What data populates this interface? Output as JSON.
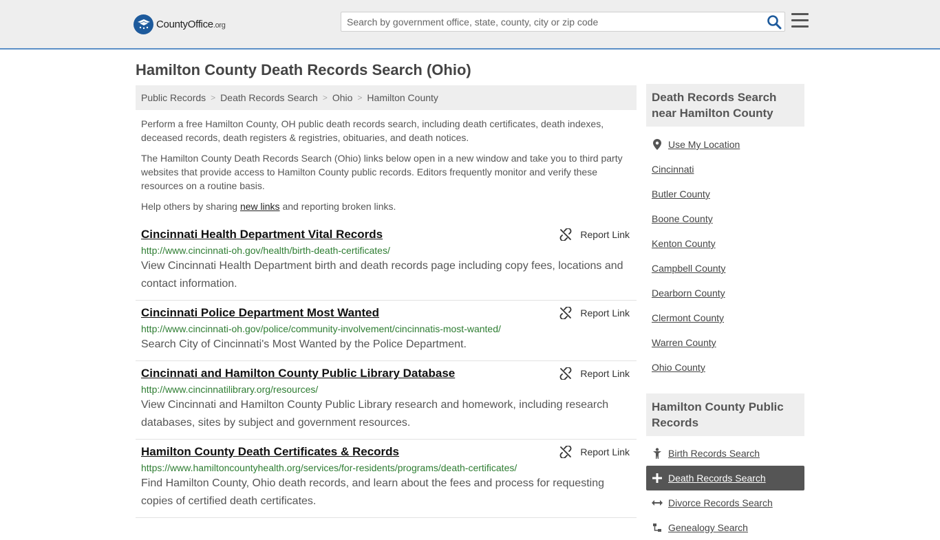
{
  "header": {
    "logo_main": "CountyOffice",
    "logo_tld": ".org",
    "search_placeholder": "Search by government office, state, county, city or zip code"
  },
  "page": {
    "title": "Hamilton County Death Records Search (Ohio)"
  },
  "breadcrumb": [
    "Public Records",
    "Death Records Search",
    "Ohio",
    "Hamilton County"
  ],
  "intro": {
    "p1": "Perform a free Hamilton County, OH public death records search, including death certificates, death indexes, deceased records, death registers & registries, obituaries, and death notices.",
    "p2": "The Hamilton County Death Records Search (Ohio) links below open in a new window and take you to third party websites that provide access to Hamilton County public records. Editors frequently monitor and verify these resources on a routine basis.",
    "p3_before": "Help others by sharing ",
    "p3_link": "new links",
    "p3_after": " and reporting broken links."
  },
  "report_label": "Report Link",
  "results": [
    {
      "title": "Cincinnati Health Department Vital Records",
      "url": "http://www.cincinnati-oh.gov/health/birth-death-certificates/",
      "desc": "View Cincinnati Health Department birth and death records page including copy fees, locations and contact information."
    },
    {
      "title": "Cincinnati Police Department Most Wanted",
      "url": "http://www.cincinnati-oh.gov/police/community-involvement/cincinnatis-most-wanted/",
      "desc": "Search City of Cincinnati's Most Wanted by the Police Department."
    },
    {
      "title": "Cincinnati and Hamilton County Public Library Database",
      "url": "http://www.cincinnatilibrary.org/resources/",
      "desc": "View Cincinnati and Hamilton County Public Library research and homework, including research databases, sites by subject and government resources."
    },
    {
      "title": "Hamilton County Death Certificates & Records",
      "url": "https://www.hamiltoncountyhealth.org/services/for-residents/programs/death-certificates/",
      "desc": "Find Hamilton County, Ohio death records, and learn about the fees and process for requesting copies of certified death certificates."
    }
  ],
  "sidebar": {
    "near_title": "Death Records Search near Hamilton County",
    "use_location": "Use My Location",
    "near_items": [
      "Cincinnati",
      "Butler County",
      "Boone County",
      "Kenton County",
      "Campbell County",
      "Dearborn County",
      "Clermont County",
      "Warren County",
      "Ohio County"
    ],
    "public_title": "Hamilton County Public Records",
    "public_items": [
      {
        "label": "Birth Records Search",
        "icon": "person-icon"
      },
      {
        "label": "Death Records Search",
        "icon": "plus-icon",
        "active": true
      },
      {
        "label": "Divorce Records Search",
        "icon": "arrows-horizontal-icon"
      },
      {
        "label": "Genealogy Search",
        "icon": "tree-icon"
      }
    ]
  },
  "colors": {
    "brand_blue": "#1d5a9c",
    "header_border": "#5b8fc7",
    "url_green": "#2e7d32",
    "active_bg": "#555555"
  }
}
